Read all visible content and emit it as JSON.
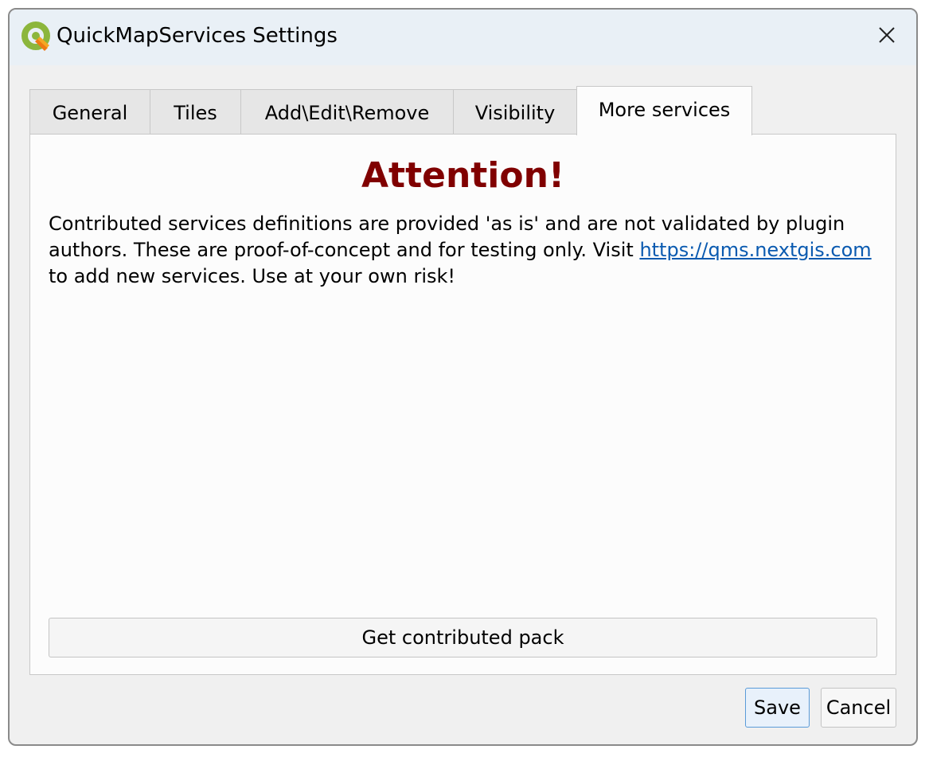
{
  "window": {
    "title": "QuickMapServices Settings",
    "app_icon": "qgis-logo-icon",
    "close_icon": "close-icon"
  },
  "tabs": [
    {
      "label": "General",
      "active": false
    },
    {
      "label": "Tiles",
      "active": false
    },
    {
      "label": "Add\\Edit\\Remove",
      "active": false
    },
    {
      "label": "Visibility",
      "active": false
    },
    {
      "label": "More services",
      "active": true
    }
  ],
  "more_services": {
    "heading": "Attention!",
    "notice_before": "Contributed services definitions are provided 'as is' and are not validated by plugin authors. These are proof-of-concept and for testing only. Visit ",
    "link_text": "https://qms.nextgis.com",
    "notice_after": " to add new services. Use at your own risk!",
    "get_pack_label": "Get contributed pack"
  },
  "footer": {
    "save_label": "Save",
    "cancel_label": "Cancel"
  },
  "colors": {
    "heading": "#800000",
    "link": "#0a5ab0",
    "default_button_border": "#5a9bd8"
  }
}
